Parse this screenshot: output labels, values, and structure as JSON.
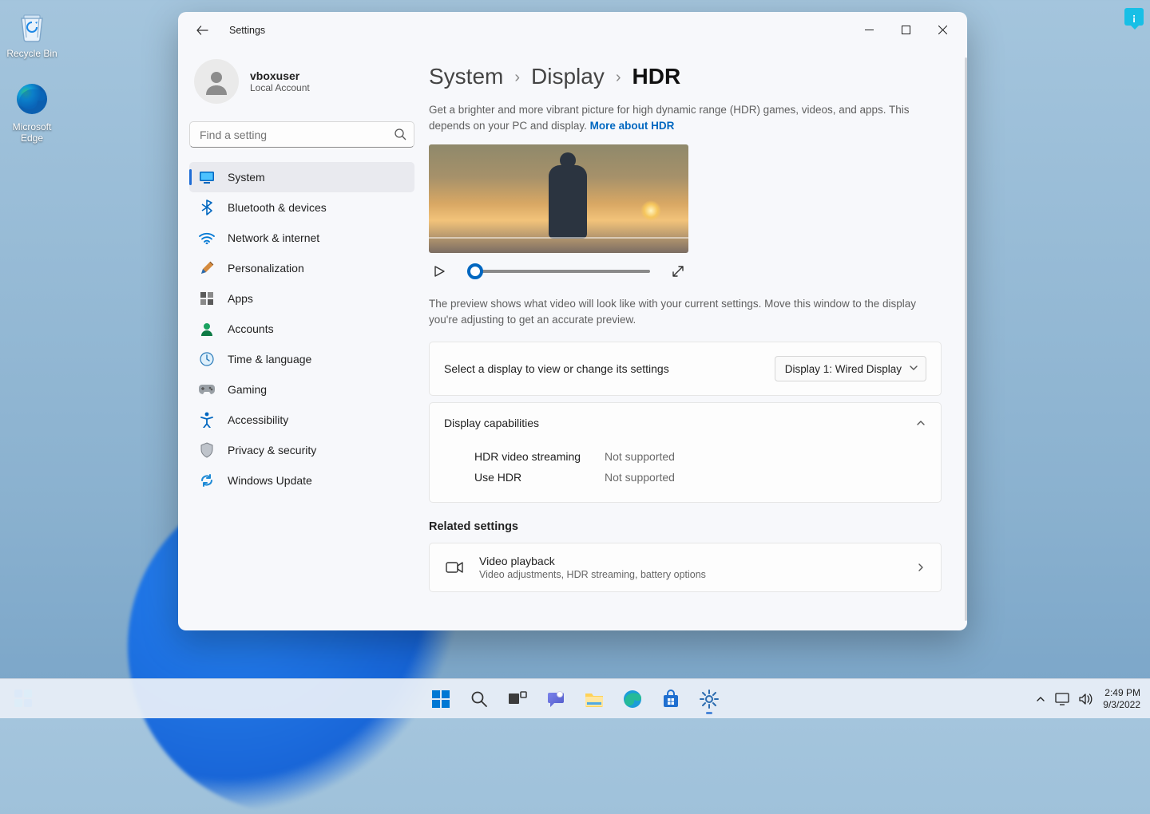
{
  "desktop": {
    "recycle_bin": "Recycle Bin",
    "edge": "Microsoft Edge"
  },
  "window": {
    "title": "Settings",
    "user": {
      "name": "vboxuser",
      "account_type": "Local Account"
    },
    "search": {
      "placeholder": "Find a setting"
    },
    "nav": {
      "system": "System",
      "bluetooth": "Bluetooth & devices",
      "network": "Network & internet",
      "personalization": "Personalization",
      "apps": "Apps",
      "accounts": "Accounts",
      "time": "Time & language",
      "gaming": "Gaming",
      "accessibility": "Accessibility",
      "privacy": "Privacy & security",
      "update": "Windows Update"
    },
    "breadcrumb": {
      "a": "System",
      "b": "Display",
      "c": "HDR"
    },
    "description": "Get a brighter and more vibrant picture for high dynamic range (HDR) games, videos, and apps. This depends on your PC and display. ",
    "more_link": "More about HDR",
    "preview_note": "The preview shows what video will look like with your current settings. Move this window to the display you're adjusting to get an accurate preview.",
    "display_select": {
      "label": "Select a display to view or change its settings",
      "value": "Display 1: Wired Display"
    },
    "capabilities": {
      "heading": "Display capabilities",
      "rows": [
        {
          "k": "HDR video streaming",
          "v": "Not supported"
        },
        {
          "k": "Use HDR",
          "v": "Not supported"
        }
      ]
    },
    "related": {
      "heading": "Related settings",
      "video": {
        "title": "Video playback",
        "sub": "Video adjustments, HDR streaming, battery options"
      }
    }
  },
  "taskbar": {
    "time": "2:49 PM",
    "date": "9/3/2022"
  }
}
